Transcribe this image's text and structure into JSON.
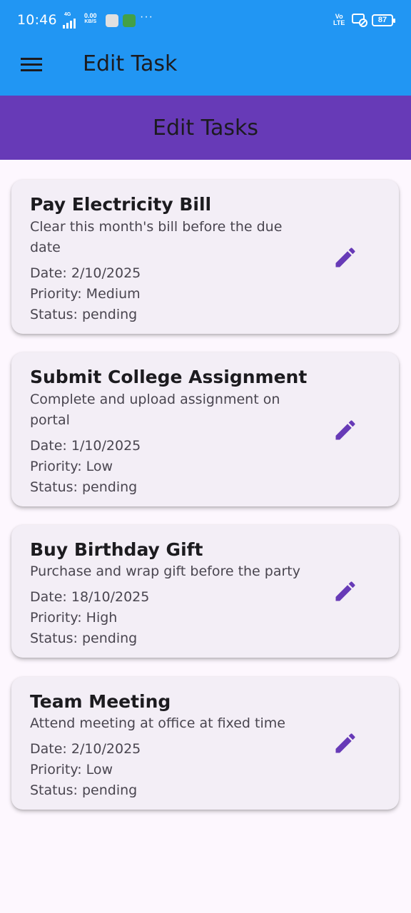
{
  "status_bar": {
    "time": "10:46",
    "network": "4G",
    "speed_value": "0.00",
    "speed_unit": "KB/S",
    "more": "···",
    "volte_top": "Vo",
    "volte_bottom": "LTE",
    "battery": "87"
  },
  "app_bar": {
    "title": "Edit Task",
    "menu_icon": "hamburger-menu-icon",
    "background": "#2196f3"
  },
  "banner": {
    "title": "Edit Tasks",
    "background": "#673ab7"
  },
  "accent": "#673ab7",
  "tasks": [
    {
      "title": "Pay Electricity Bill",
      "description": "Clear this month's bill before the due date",
      "date": "Date: 2/10/2025",
      "priority": "Priority: Medium",
      "status": "Status: pending",
      "action_icon": "edit-icon"
    },
    {
      "title": "Submit College Assignment",
      "description": "Complete and upload assignment on portal",
      "date": "Date: 1/10/2025",
      "priority": "Priority: Low",
      "status": "Status: pending",
      "action_icon": "edit-icon"
    },
    {
      "title": "Buy Birthday Gift",
      "description": "Purchase and wrap gift before the party",
      "date": "Date: 18/10/2025",
      "priority": "Priority: High",
      "status": "Status: pending",
      "action_icon": "edit-icon"
    },
    {
      "title": "Team Meeting",
      "description": "Attend meeting at office at fixed time",
      "date": "Date: 2/10/2025",
      "priority": "Priority: Low",
      "status": "Status: pending",
      "action_icon": "edit-icon"
    }
  ]
}
